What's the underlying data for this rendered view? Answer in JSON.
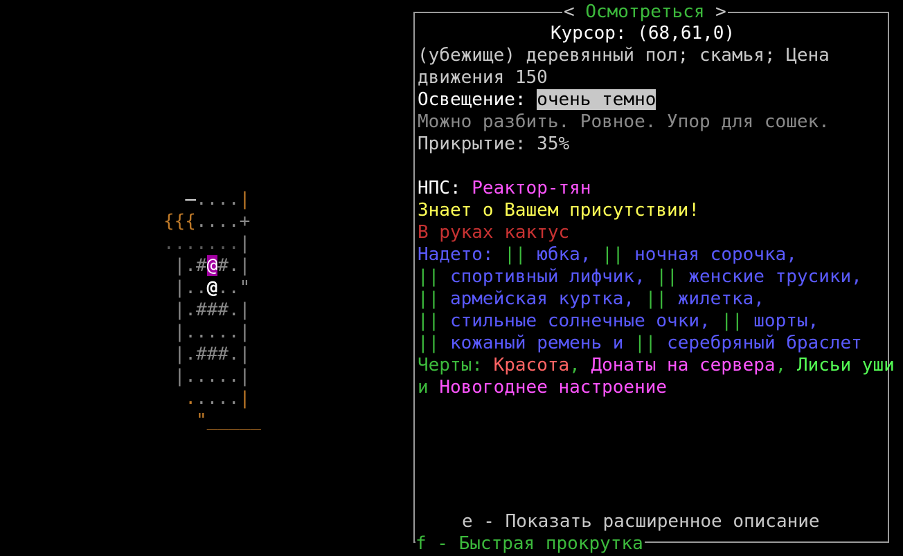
{
  "map": {
    "rows": [
      [
        [
          "  ",
          "c-grey"
        ],
        [
          "–",
          "c-white"
        ],
        [
          "....",
          "c-grey"
        ],
        [
          "|",
          "c-orange"
        ]
      ],
      [
        [
          "{{{",
          "c-brown"
        ],
        [
          "....",
          "c-grey"
        ],
        [
          "+",
          "c-grey"
        ]
      ],
      [
        [
          ".......",
          "c-dark"
        ],
        [
          "|",
          "c-wall"
        ]
      ],
      [
        [
          " |.#",
          "c-wall"
        ],
        [
          "@",
          "c-npc"
        ],
        [
          "#.",
          "c-wall"
        ],
        [
          "|",
          "c-wall"
        ]
      ],
      [
        [
          " |..",
          "c-wall"
        ],
        [
          "@",
          "c-me"
        ],
        [
          "..",
          "c-wall"
        ],
        [
          "\"",
          "c-grey"
        ]
      ],
      [
        [
          " |.###.",
          "c-wall"
        ],
        [
          "|",
          "c-wall"
        ]
      ],
      [
        [
          " |.....",
          "c-wall"
        ],
        [
          "|",
          "c-wall"
        ]
      ],
      [
        [
          " |.###.",
          "c-wall"
        ],
        [
          "|",
          "c-wall"
        ]
      ],
      [
        [
          " |.....",
          "c-wall"
        ],
        [
          "|",
          "c-wall"
        ]
      ],
      [
        [
          "  ",
          "c-grey"
        ],
        [
          ".",
          "c-orange"
        ],
        [
          "....",
          "c-wall"
        ],
        [
          "|",
          "c-orange"
        ]
      ],
      [
        [
          "   ",
          "c-grey"
        ],
        [
          "\"",
          "c-orange"
        ],
        [
          "_____",
          "c-orange"
        ]
      ]
    ]
  },
  "panel": {
    "title": "Осмотреться",
    "title_left": "< ",
    "title_right": " >",
    "cursor_label": "Курсор: (68,61,0)",
    "tile_desc_1": "(убежище) деревянный пол; скамья; Цена",
    "tile_desc_2": "движения 150",
    "lighting_label": "Освещение: ",
    "lighting_value": "очень темно",
    "props": "Можно разбить. Ровное. Упор для сошек.",
    "cover": "Прикрытие: 35%",
    "npc_label": "НПС: ",
    "npc_name": "Реактор-тян",
    "aware": "Знает о Вашем присутствии!",
    "wielding": "В руках кактус",
    "worn_label": "Надето: ",
    "worn_items": [
      "юбка",
      "ночная сорочка",
      "спортивный лифчик",
      "женские трусики",
      "армейская куртка",
      "жилетка",
      "стильные солнечные очки",
      "шорты",
      "кожаный ремень",
      "серебряный браслет"
    ],
    "worn_mark": "||",
    "worn_and": "и",
    "traits_label": "Черты: ",
    "traits": [
      "Красота",
      "Донаты на сервера",
      "Лисьи уши",
      "Новогоднее настроение"
    ],
    "traits_and": "и",
    "hint_e": "e - Показать расширенное описание",
    "hint_f": "f - Быстрая прокрутка"
  },
  "colors": {
    "title": "#3cba3c",
    "npc_name": "#ff55ff",
    "aware": "#ffff55",
    "wielding": "#c83232",
    "worn": "#5a5aff",
    "marks": "#3cba3c"
  }
}
